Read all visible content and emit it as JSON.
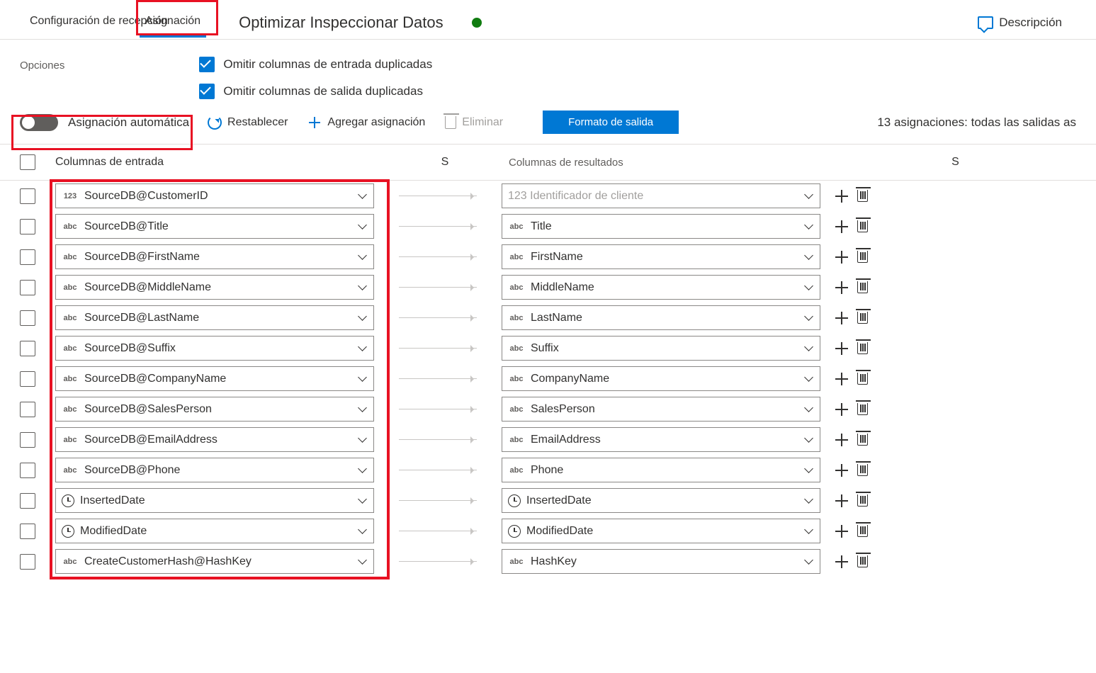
{
  "tabs": {
    "reception": "Configuración de recepción",
    "assignment": "Asignación",
    "optimize": "Optimizar Inspeccionar Datos"
  },
  "description_label": "Descripción",
  "options": {
    "label": "Opciones",
    "skip_dup_input": "Omitir columnas de entrada duplicadas",
    "skip_dup_output": "Omitir columnas de salida duplicadas"
  },
  "toolbar": {
    "auto_map": "Asignación automática",
    "reset": "Restablecer",
    "add": "Agregar asignación",
    "delete": "Eliminar",
    "output_format": "Formato de salida",
    "status": "13 asignaciones: todas las salidas as"
  },
  "headers": {
    "input": "Columnas de entrada",
    "s1": "S",
    "output": "Columnas de resultados",
    "s2": "S"
  },
  "rows": [
    {
      "in_type": "123",
      "in": "SourceDB@CustomerID",
      "out_type": "123",
      "out": "Identificador de cliente",
      "out_placeholder": true
    },
    {
      "in_type": "abc",
      "in": "SourceDB@Title",
      "out_type": "abc",
      "out": "Title"
    },
    {
      "in_type": "abc",
      "in": "SourceDB@FirstName",
      "out_type": "abc",
      "out": "FirstName"
    },
    {
      "in_type": "abc",
      "in": "SourceDB@MiddleName",
      "out_type": "abc",
      "out": "MiddleName"
    },
    {
      "in_type": "abc",
      "in": "SourceDB@LastName",
      "out_type": "abc",
      "out": "LastName"
    },
    {
      "in_type": "abc",
      "in": "SourceDB@Suffix",
      "out_type": "abc",
      "out": "Suffix"
    },
    {
      "in_type": "abc",
      "in": "SourceDB@CompanyName",
      "out_type": "abc",
      "out": "CompanyName"
    },
    {
      "in_type": "abc",
      "in": "SourceDB@SalesPerson",
      "out_type": "abc",
      "out": "SalesPerson"
    },
    {
      "in_type": "abc",
      "in": "SourceDB@EmailAddress",
      "out_type": "abc",
      "out": "EmailAddress"
    },
    {
      "in_type": "abc",
      "in": "SourceDB@Phone",
      "out_type": "abc",
      "out": "Phone"
    },
    {
      "in_type": "clock",
      "in": "InsertedDate",
      "out_type": "clock",
      "out": "InsertedDate"
    },
    {
      "in_type": "clock",
      "in": "ModifiedDate",
      "out_type": "clock",
      "out": "ModifiedDate"
    },
    {
      "in_type": "abc",
      "in": "CreateCustomerHash@HashKey",
      "out_type": "abc",
      "out": "HashKey"
    }
  ]
}
